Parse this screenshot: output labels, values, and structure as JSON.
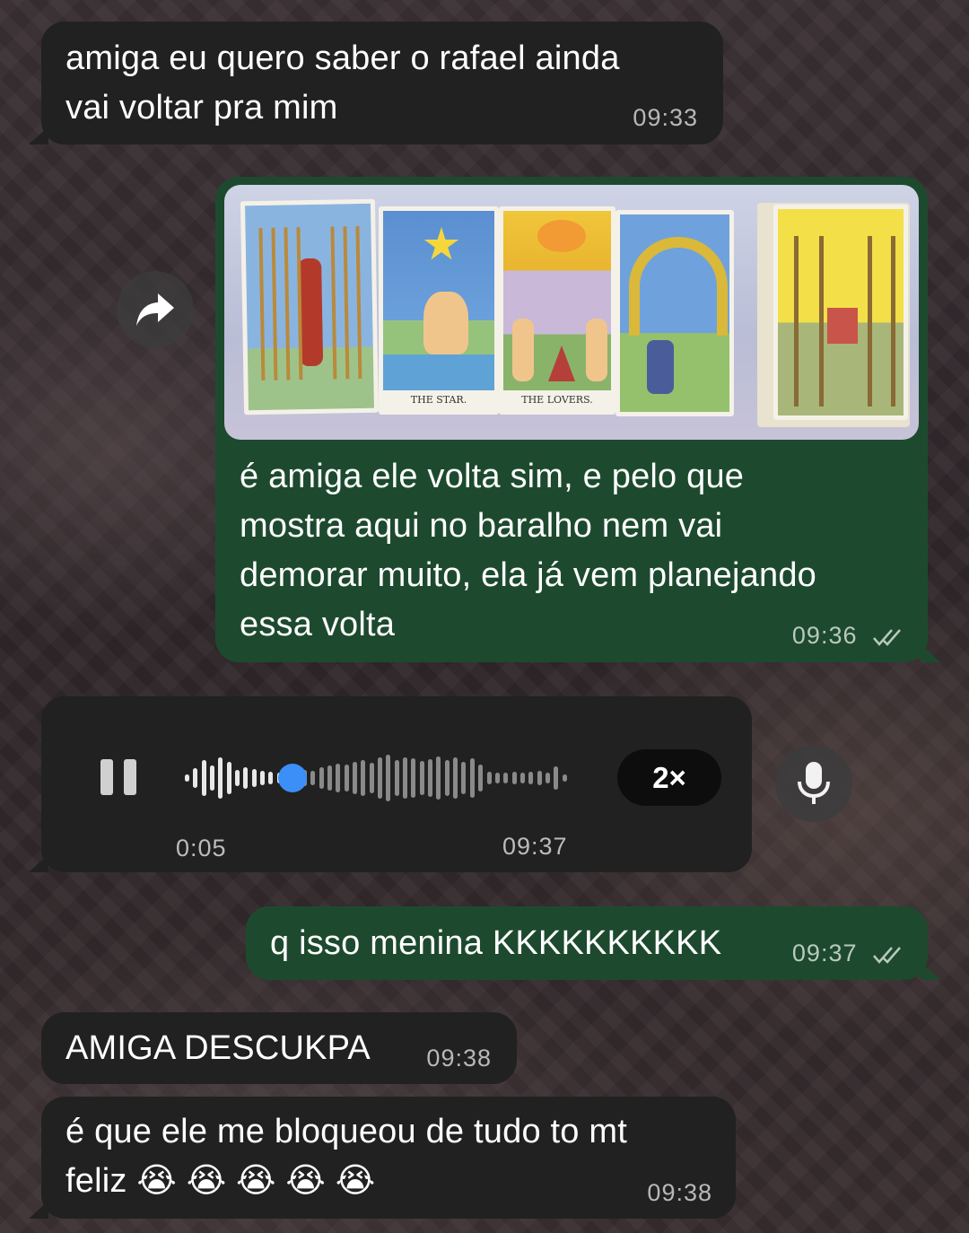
{
  "messages": [
    {
      "text_line1": "amiga eu quero saber o rafael ainda",
      "text_line2": "vai voltar pra mim",
      "time": "09:33"
    },
    {
      "image_captions": [
        "THE STAR.",
        "THE LOVERS."
      ],
      "text_lines": [
        "é amiga ele volta sim, e pelo que",
        "mostra aqui no baralho nem vai",
        "demorar muito, ela já vem planejando",
        "essa volta"
      ],
      "time": "09:36"
    },
    {
      "voice": {
        "elapsed": "0:05",
        "time": "09:37",
        "speed": "2×",
        "progress": 0.28
      }
    },
    {
      "text": "q isso menina KKKKKKKKKK",
      "time": "09:37"
    },
    {
      "text": "AMIGA DESCUKPA",
      "time": "09:38"
    },
    {
      "text_line1": "é que ele me bloqueou de tudo to mt",
      "text_line2": "feliz 😭 😭 😭 😭 😭",
      "time": "09:38"
    }
  ],
  "colors": {
    "incoming": "#212121",
    "outgoing": "#1d4a2e",
    "accent": "#3b8ff7"
  },
  "icons": [
    "forward-icon",
    "pause-icon",
    "microphone-icon",
    "double-check-icon"
  ]
}
